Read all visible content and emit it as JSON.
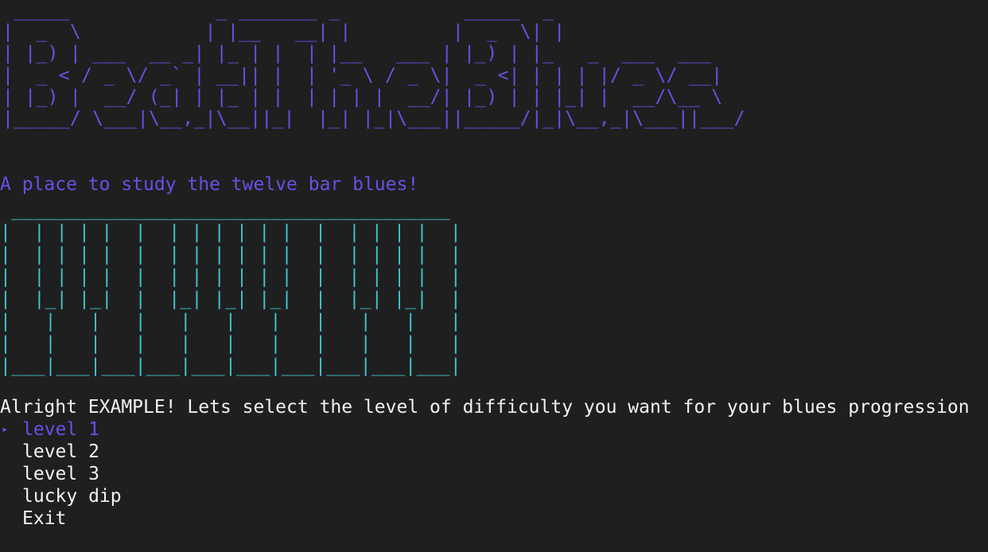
{
  "logo_ascii": " _____             _ _______ _           _____  _\n|  _  \\           | |__   __| |         |  _  \\| |\n| |_) | ___  __ _| |_ | |  | |__   ___ | |_) | |_   _  ___  ___\n|  _ < / _ \\/ _` | __|| |  | '_ \\ / _ \\|  _ <| | | | |/ _ \\/ __|\n| |_) |  __/ (_| | |_ | |  | | | |  __/| |_) | | |_| |  __/\\__ \\\n|_____/ \\___|\\__,_|\\__||_|  |_| |_|\\___||_____/|_|\\__,_|\\___||___/",
  "tagline": "A place to study the twelve bar blues!",
  "piano_ascii": " _______________________________________\n|  | | | |  |  | | | | | |  |  | | | |  |\n|  | | | |  |  | | | | | |  |  | | | |  |\n|  | | | |  |  | | | | | |  |  | | | |  |\n|  |_| |_|  |  |_| |_| |_|  |  |_| |_|  |\n|   |   |   |   |   |   |   |   |   |   |\n|   |   |   |   |   |   |   |   |   |   |\n|___|___|___|___|___|___|___|___|___|___|",
  "prompt": "Alright EXAMPLE! Lets select the level of difficulty you want for your blues progression",
  "menu": {
    "cursor_glyph": "▸",
    "selected_index": 0,
    "items": [
      {
        "label": "level 1"
      },
      {
        "label": "level 2"
      },
      {
        "label": "level 3"
      },
      {
        "label": "lucky dip"
      },
      {
        "label": "Exit"
      }
    ]
  },
  "colors": {
    "background": "#1f1f1f",
    "accent_purple": "#6b4fe6",
    "piano_cyan": "#3fc3cc",
    "text": "#f2f2f2"
  }
}
